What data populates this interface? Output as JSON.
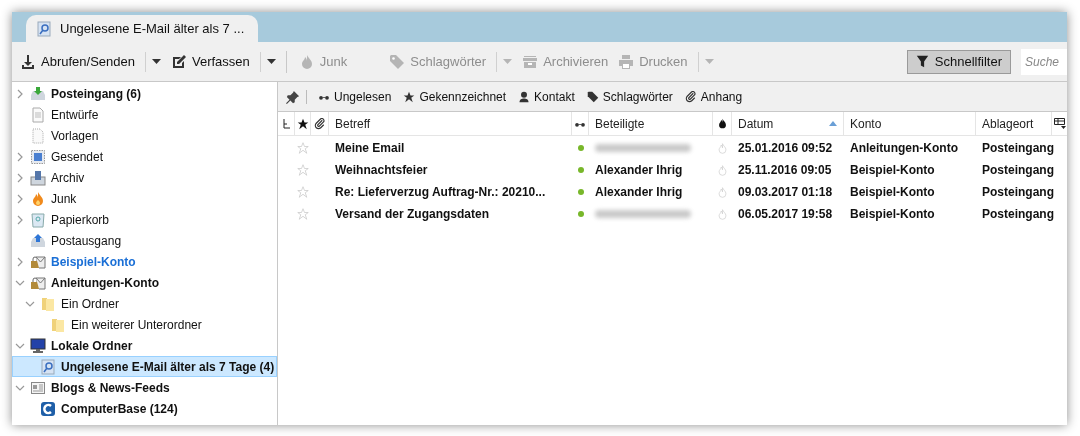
{
  "tab": {
    "title": "Ungelesene E-Mail älter als 7 ..."
  },
  "toolbar": {
    "buttons": [
      {
        "kind": "download",
        "label": "Abrufen/Senden",
        "disabled": false,
        "dropdown": true
      },
      {
        "kind": "compose",
        "label": "Verfassen",
        "disabled": false,
        "dropdown": true
      },
      {
        "kind": "junk",
        "label": "Junk",
        "disabled": true,
        "dropdown": false
      },
      {
        "kind": "tag",
        "label": "Schlagwörter",
        "disabled": true,
        "dropdown": true
      },
      {
        "kind": "archive",
        "label": "Archivieren",
        "disabled": true,
        "dropdown": false
      },
      {
        "kind": "print",
        "label": "Drucken",
        "disabled": true,
        "dropdown": true
      }
    ],
    "quick_filter": {
      "label": "Schnellfilter",
      "on": true
    },
    "search": {
      "placeholder": "Suche"
    }
  },
  "folders": [
    {
      "kind": "inbox",
      "label": "Posteingang (6)",
      "unread": true,
      "new_mail": false,
      "selected": false,
      "expanded": false
    },
    {
      "kind": "drafts",
      "label": "Entwürfe",
      "unread": false,
      "new_mail": false,
      "selected": false
    },
    {
      "kind": "templates",
      "label": "Vorlagen",
      "unread": false,
      "new_mail": false,
      "selected": false
    },
    {
      "kind": "sent",
      "label": "Gesendet",
      "unread": false,
      "new_mail": false,
      "selected": false,
      "expanded": false
    },
    {
      "kind": "archive",
      "label": "Archiv",
      "unread": false,
      "new_mail": false,
      "selected": false,
      "expanded": false
    },
    {
      "kind": "junk",
      "label": "Junk",
      "unread": false,
      "new_mail": false,
      "selected": false,
      "expanded": false
    },
    {
      "kind": "trash",
      "label": "Papierkorb",
      "unread": false,
      "new_mail": false,
      "selected": false,
      "expanded": false
    },
    {
      "kind": "outbox",
      "label": "Postausgang",
      "unread": false,
      "new_mail": false,
      "selected": false
    },
    {
      "kind": "account",
      "label": "Beispiel-Konto",
      "unread": true,
      "new_mail": true,
      "selected": false,
      "expanded": false
    },
    {
      "kind": "account",
      "label": "Anleitungen-Konto",
      "unread": true,
      "new_mail": false,
      "selected": false,
      "expanded": true,
      "children": [
        {
          "kind": "folder",
          "label": "Ein Ordner",
          "unread": false,
          "new_mail": false,
          "selected": false,
          "expanded": true,
          "children": [
            {
              "kind": "folder",
              "label": "Ein weiterer Unterordner",
              "unread": false,
              "new_mail": false,
              "selected": false
            }
          ]
        }
      ]
    },
    {
      "kind": "local",
      "label": "Lokale Ordner",
      "unread": true,
      "new_mail": false,
      "selected": false,
      "expanded": true,
      "children": [
        {
          "kind": "search",
          "label": "Ungelesene E-Mail älter als 7 Tage (4)",
          "unread": true,
          "new_mail": false,
          "selected": true
        }
      ]
    },
    {
      "kind": "feeds",
      "label": "Blogs & News-Feeds",
      "unread": true,
      "new_mail": false,
      "selected": false,
      "expanded": true,
      "children": [
        {
          "kind": "feed",
          "label": "ComputerBase (124)",
          "unread": true,
          "new_mail": false,
          "selected": false
        }
      ]
    }
  ],
  "filter_bar": {
    "buttons": [
      {
        "kind": "unread",
        "label": "Ungelesen",
        "on": false
      },
      {
        "kind": "star",
        "label": "Gekennzeichnet",
        "on": false
      },
      {
        "kind": "contact",
        "label": "Kontakt",
        "on": false
      },
      {
        "kind": "tag",
        "label": "Schlagwörter",
        "on": false
      },
      {
        "kind": "attachment",
        "label": "Anhang",
        "on": false
      }
    ]
  },
  "table": {
    "columns": [
      {
        "kind": "thread"
      },
      {
        "kind": "star"
      },
      {
        "kind": "attachment"
      },
      {
        "kind": "text",
        "label": "Betreff"
      },
      {
        "kind": "read"
      },
      {
        "kind": "text",
        "label": "Beteiligte"
      },
      {
        "kind": "junk"
      },
      {
        "kind": "text",
        "label": "Datum",
        "sorted": true
      },
      {
        "kind": "text",
        "label": "Konto"
      },
      {
        "kind": "text",
        "label": "Ablageort"
      },
      {
        "kind": "picker"
      }
    ],
    "rows": [
      {
        "subject": "Meine Email",
        "starred": false,
        "unread": true,
        "sender": null,
        "date": "25.01.2016 09:52",
        "account": "Anleitungen-Konto",
        "location": "Posteingang"
      },
      {
        "subject": "Weihnachtsfeier",
        "starred": false,
        "unread": true,
        "sender": "Alexander Ihrig",
        "date": "25.11.2016 09:05",
        "account": "Beispiel-Konto",
        "location": "Posteingang"
      },
      {
        "subject": "Re: Lieferverzug Auftrag-Nr.: 20210...",
        "starred": false,
        "unread": true,
        "sender": "Alexander Ihrig",
        "date": "09.03.2017 01:18",
        "account": "Beispiel-Konto",
        "location": "Posteingang"
      },
      {
        "subject": "Versand der Zugangsdaten",
        "starred": false,
        "unread": true,
        "sender": null,
        "date": "06.05.2017 19:58",
        "account": "Beispiel-Konto",
        "location": "Posteingang"
      }
    ]
  }
}
